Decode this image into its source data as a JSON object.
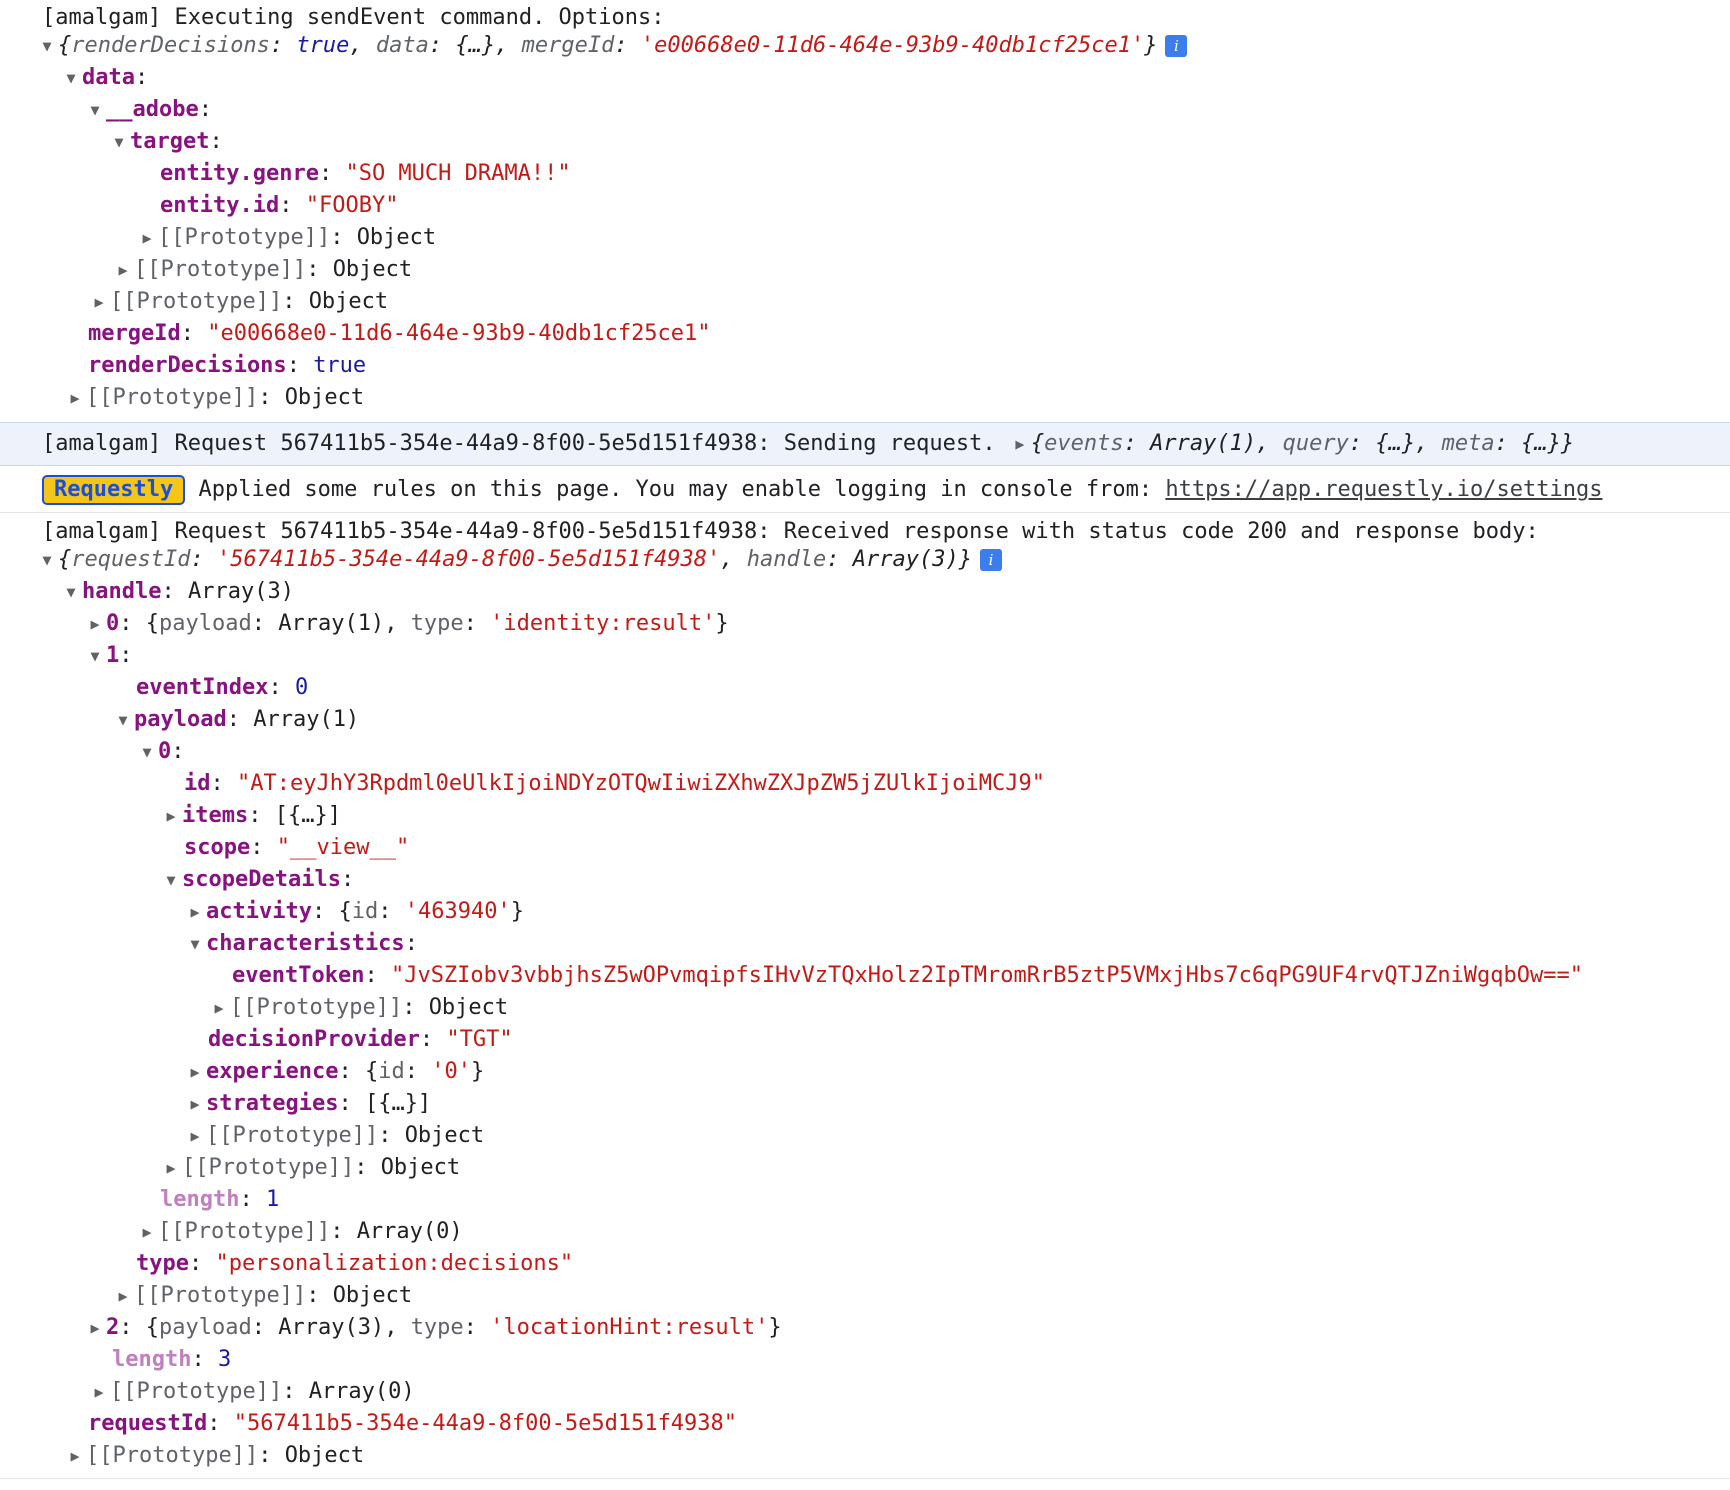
{
  "log1": {
    "header": "[amalgam] Executing sendEvent command. Options:",
    "summary": {
      "open": "{",
      "k1": "renderDecisions",
      "v1": "true",
      "k2": "data",
      "v2": "{…}",
      "k3": "mergeId",
      "v3": "'e00668e0-11d6-464e-93b9-40db1cf25ce1'",
      "close": "}"
    },
    "data_key": "data",
    "adobe_key": "__adobe",
    "target_key": "target",
    "genre_key": "entity.genre",
    "genre_val": "\"SO MUCH DRAMA!!\"",
    "id_key": "entity.id",
    "id_val": "\"FOOBY\"",
    "mergeId_key": "mergeId",
    "mergeId_val": "\"e00668e0-11d6-464e-93b9-40db1cf25ce1\"",
    "render_key": "renderDecisions",
    "render_val": "true"
  },
  "proto": {
    "label": "[[Prototype]]",
    "object": "Object",
    "array0": "Array(0)"
  },
  "log2": {
    "text": "[amalgam] Request 567411b5-354e-44a9-8f00-5e5d151f4938: Sending request.",
    "open": "{",
    "k1": "events",
    "v1": "Array(1)",
    "k2": "query",
    "v2": "{…}",
    "k3": "meta",
    "v3": "{…}",
    "close": "}"
  },
  "requestly": {
    "badge": "Requestly",
    "text": "Applied some rules on this page. You may enable logging in console from:",
    "link": "https://app.requestly.io/settings"
  },
  "log3": {
    "header": "[amalgam] Request 567411b5-354e-44a9-8f00-5e5d151f4938: Received response with status code 200 and response body:",
    "summary": {
      "open": "{",
      "k1": "requestId",
      "v1": "'567411b5-354e-44a9-8f00-5e5d151f4938'",
      "k2": "handle",
      "v2": "Array(3)",
      "close": "}"
    },
    "handle_key": "handle",
    "handle_val": "Array(3)",
    "h0_key": "0",
    "h0_payload_key": "payload",
    "h0_payload_val": "Array(1)",
    "h0_type_key": "type",
    "h0_type_val": "'identity:result'",
    "h1_key": "1",
    "eventIndex_key": "eventIndex",
    "eventIndex_val": "0",
    "payload_key": "payload",
    "payload_val": "Array(1)",
    "p0_key": "0",
    "id_key": "id",
    "id_val": "\"AT:eyJhY3Rpdml0eUlkIjoiNDYzOTQwIiwiZXhwZXJpZW5jZUlkIjoiMCJ9\"",
    "items_key": "items",
    "items_val": "[{…}]",
    "scope_key": "scope",
    "scope_val": "\"__view__\"",
    "scopeDetails_key": "scopeDetails",
    "activity_key": "activity",
    "activity_inner_key": "id",
    "activity_inner_val": "'463940'",
    "characteristics_key": "characteristics",
    "eventToken_key": "eventToken",
    "eventToken_val": "\"JvSZIobv3vbbjhsZ5wOPvmqipfsIHvVzTQxHolz2IpTMromRrB5ztP5VMxjHbs7c6qPG9UF4rvQTJZniWgqbOw==\"",
    "decisionProvider_key": "decisionProvider",
    "decisionProvider_val": "\"TGT\"",
    "experience_key": "experience",
    "experience_inner_key": "id",
    "experience_inner_val": "'0'",
    "strategies_key": "strategies",
    "strategies_val": "[{…}]",
    "length_key": "length",
    "payload_length_val": "1",
    "type_key": "type",
    "type_val": "\"personalization:decisions\"",
    "h2_key": "2",
    "h2_payload_key": "payload",
    "h2_payload_val": "Array(3)",
    "h2_type_key": "type",
    "h2_type_val": "'locationHint:result'",
    "handle_length_val": "3",
    "requestId_key": "requestId",
    "requestId_val": "\"567411b5-354e-44a9-8f00-5e5d151f4938\""
  },
  "icons": {
    "expanded": "▼",
    "collapsed": "▶",
    "info": "i"
  }
}
